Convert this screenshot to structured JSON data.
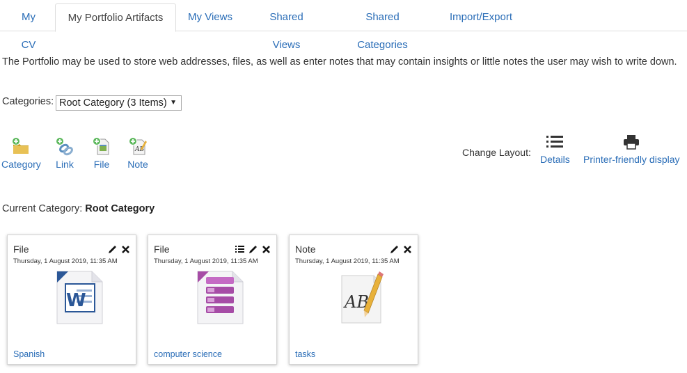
{
  "tabs": [
    {
      "label": "My CV",
      "active": false
    },
    {
      "label": "My Portfolio Artifacts",
      "active": true
    },
    {
      "label": "My Views",
      "active": false
    },
    {
      "label": "Shared Views",
      "active": false
    },
    {
      "label": "Shared Categories",
      "active": false
    },
    {
      "label": "Import/Export",
      "active": false
    }
  ],
  "intro": "The Portfolio may be used to store web addresses, files, as well as enter notes that may contain insights or little notes the user may wish to write down.",
  "categories": {
    "label": "Categories:",
    "selected": "Root Category (3 Items)"
  },
  "add_tools": [
    {
      "label": "Category",
      "icon": "add-folder-icon"
    },
    {
      "label": "Link",
      "icon": "add-link-icon"
    },
    {
      "label": "File",
      "icon": "add-file-icon"
    },
    {
      "label": "Note",
      "icon": "add-note-icon"
    }
  ],
  "layout": {
    "label": "Change Layout:",
    "details": "Details",
    "printer": "Printer-friendly display"
  },
  "current_category": {
    "label": "Current Category:",
    "value": "Root Category"
  },
  "cards": [
    {
      "type": "File",
      "date": "Thursday, 1 August 2019, 11:35 AM",
      "title": "Spanish",
      "icon": "word-document-icon",
      "has_details": false
    },
    {
      "type": "File",
      "date": "Thursday, 1 August 2019, 11:35 AM",
      "title": "computer science",
      "icon": "database-document-icon",
      "has_details": true
    },
    {
      "type": "Note",
      "date": "Thursday, 1 August 2019, 11:35 AM",
      "title": "tasks",
      "icon": "note-document-icon",
      "has_details": false
    }
  ],
  "colors": {
    "link": "#2a6db7",
    "border": "#dddddd",
    "plus_green": "#5cb85c",
    "word_blue": "#2b5797",
    "db_purple": "#a64ca6"
  }
}
